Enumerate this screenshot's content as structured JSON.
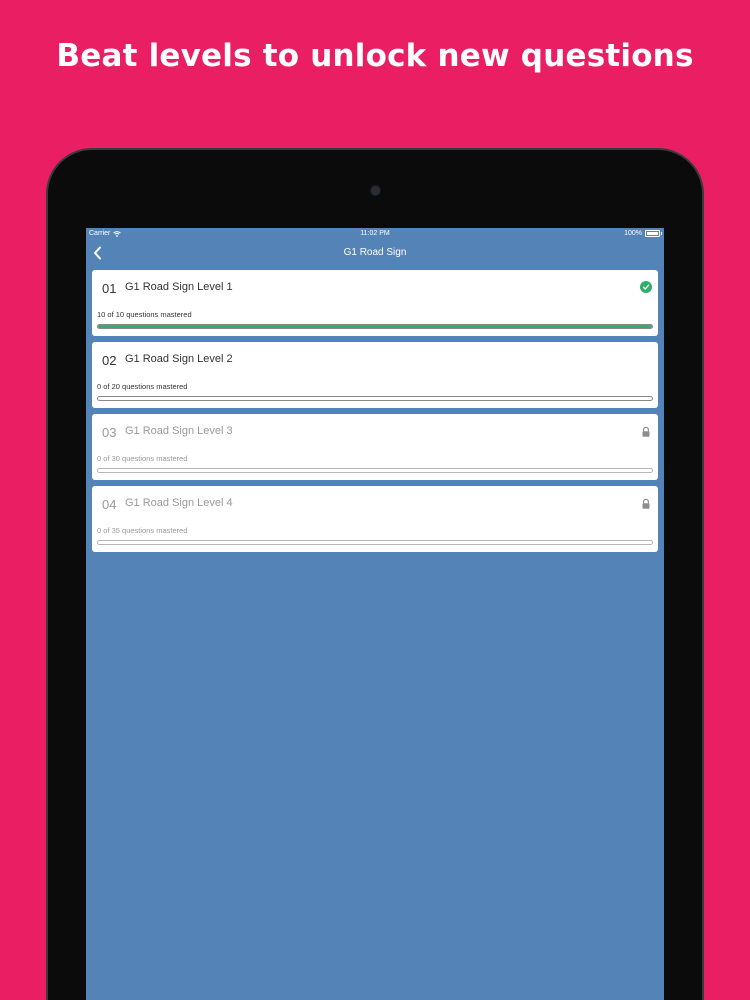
{
  "headline": "Beat levels to unlock new questions",
  "status_bar": {
    "carrier": "Carrier",
    "time": "11:02 PM",
    "battery": "100%"
  },
  "nav": {
    "title": "G1 Road Sign",
    "back_icon": "chevron-left-icon"
  },
  "levels": [
    {
      "number": "01",
      "name": "G1 Road Sign Level 1",
      "progress": "10 of 10 questions mastered",
      "progress_fraction": 1.0,
      "state": "completed",
      "icon": "check-circle-icon"
    },
    {
      "number": "02",
      "name": "G1 Road Sign Level 2",
      "progress": "0 of 20 questions mastered",
      "progress_fraction": 0.0,
      "state": "unlocked",
      "icon": ""
    },
    {
      "number": "03",
      "name": "G1 Road Sign Level 3",
      "progress": "0 of 30 questions mastered",
      "progress_fraction": 0.0,
      "state": "locked",
      "icon": "lock-icon"
    },
    {
      "number": "04",
      "name": "G1 Road Sign Level 4",
      "progress": "0 of 35 questions mastered",
      "progress_fraction": 0.0,
      "state": "locked",
      "icon": "lock-icon"
    }
  ],
  "colors": {
    "background": "#E91E63",
    "screen": "#5483B7",
    "progress": "#2FAE6E"
  }
}
